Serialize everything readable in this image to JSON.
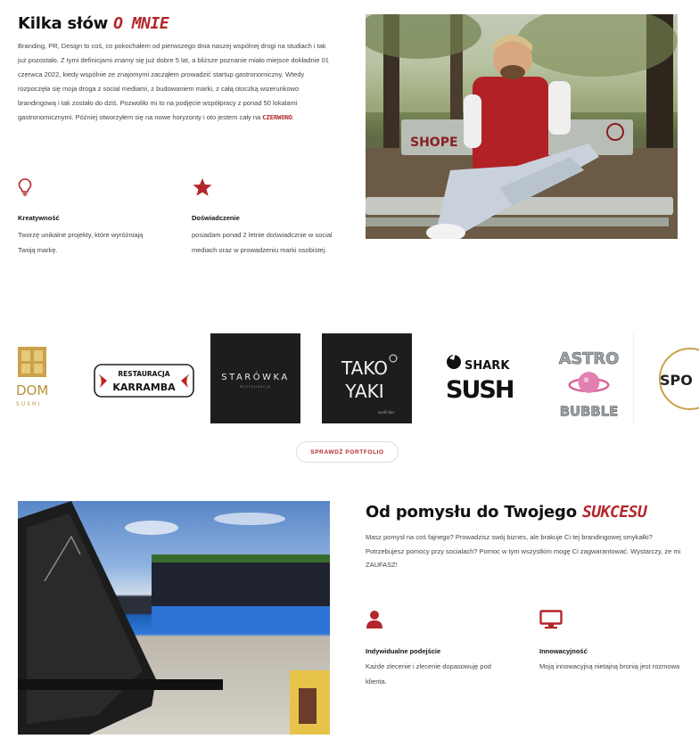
{
  "about": {
    "title": "Kilka słów",
    "title_accent": "O MNIE",
    "paragraph": "Branding, PR, Design to coś, co pokochałem od pierwszego dnia naszej wspólnej drogi na studiach i tak już pozostało. Z tymi definicjami znamy się już dobre 5 lat, a bliższe poznanie miało miejsce dokładnie 01 czerwca 2022, kiedy wspólnie ze znajomymi zacząłem prowadzić startup gastronomiczny. Wtedy rozpoczęła się moja droga z social mediami, z budowaniem marki, z całą otoczką wizerunkowo brandingową i tak zostało do dziś. Pozwoliło mi to na podjęcie współpracy z ponad 50 lokalami gastronomicznymi. Później otworzyłem się na nowe horyzonty i oto jestem cały na",
    "paragraph_brand": "CZERWONO",
    "paragraph_end": ".",
    "features": [
      {
        "icon": "lightbulb-icon",
        "title": "Kreatywność",
        "text": "Tworzę unikalne projekty, które wyróżniają Twoją markę."
      },
      {
        "icon": "star-icon",
        "title": "Doświadczenie",
        "text": "posiadam ponad 2 letnie doświadcznie w social mediach oraz w prowadzeniu marki osobistej."
      }
    ]
  },
  "logos": {
    "items": [
      "DOM SUSHI",
      "RESTAURACJA KARRAMBA",
      "STARÓWKA",
      "TAKO YAKI",
      "SHARK SUSHI",
      "ASTRO BUBBLE",
      "SPO"
    ],
    "dom_top": "DOM",
    "dom_sub": "SUSHI",
    "karramba_top": "RESTAURACJA",
    "karramba_main": "KARRAMBA",
    "starowka": "STARÓWKA",
    "starowka_sub": "RESTAURACJA",
    "tako": "TAKO",
    "yaki": "YAKI",
    "tako_sub": "sushi bar",
    "shark": "SHARK",
    "sushi": "SUSHI",
    "astro": "ASTRO",
    "bubble": "BUBBLE",
    "spo": "SPO"
  },
  "portfolio_button": "SPRAWDŹ PORTFOLIO",
  "idea": {
    "title": "Od pomysłu do Twojego",
    "title_accent": "SUKCESU",
    "paragraph": "Masz pomysł na coś fajnego? Prowadzisz swój biznes, ale brakuje Ci tej brandingowej smykałki? Potrzebujesz pomocy przy socialach? Pomoc w tym wszystkim mogę Ci zagwarantować. Wystarczy, że mi ZAUFASZ!",
    "features": [
      {
        "icon": "person-icon",
        "title": "Indywidualne podejście",
        "text": "Każde zlecenie i zlecenie dopasowuję pod klienta."
      },
      {
        "icon": "monitor-icon",
        "title": "Innowacyjność",
        "text": "Moją innowacyjną nietajną bronią jest rozmowa"
      }
    ]
  },
  "colors": {
    "accent": "#b3262b"
  }
}
